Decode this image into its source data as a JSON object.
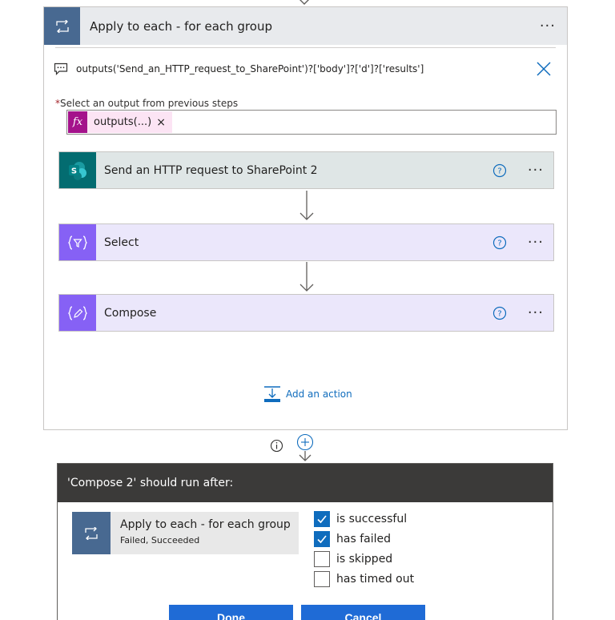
{
  "loop": {
    "title": "Apply to each - for each group",
    "more_label": "···",
    "expression": "outputs('Send_an_HTTP_request_to_SharePoint')?['body']?['d']?['results']",
    "select_label_star": "*",
    "select_label": "Select an output from previous steps",
    "token_fx": "fx",
    "token_text": "outputs(...)",
    "token_remove": "×"
  },
  "actions": [
    {
      "label": "Send an HTTP request to SharePoint 2",
      "icon": "sharepoint-icon",
      "more_label": "···"
    },
    {
      "label": "Select",
      "icon": "select-icon",
      "more_label": "···"
    },
    {
      "label": "Compose",
      "icon": "compose-icon",
      "more_label": "···"
    }
  ],
  "add_action_label": "Add an action",
  "dialog": {
    "title": "'Compose 2' should run after:",
    "dependency": {
      "title": "Apply to each - for each group",
      "status": "Failed, Succeeded"
    },
    "conditions": [
      {
        "label": "is successful",
        "checked": true
      },
      {
        "label": "has failed",
        "checked": true
      },
      {
        "label": "is skipped",
        "checked": false
      },
      {
        "label": "has timed out",
        "checked": false
      }
    ],
    "done_label": "Done",
    "cancel_label": "Cancel"
  },
  "colors": {
    "loop_icon": "#486991",
    "sharepoint": "#036c70",
    "data_ops": "#8661f5",
    "link": "#0f6cbd",
    "primary_button": "#1f6bd6",
    "dialog_header": "#3b3a39"
  }
}
